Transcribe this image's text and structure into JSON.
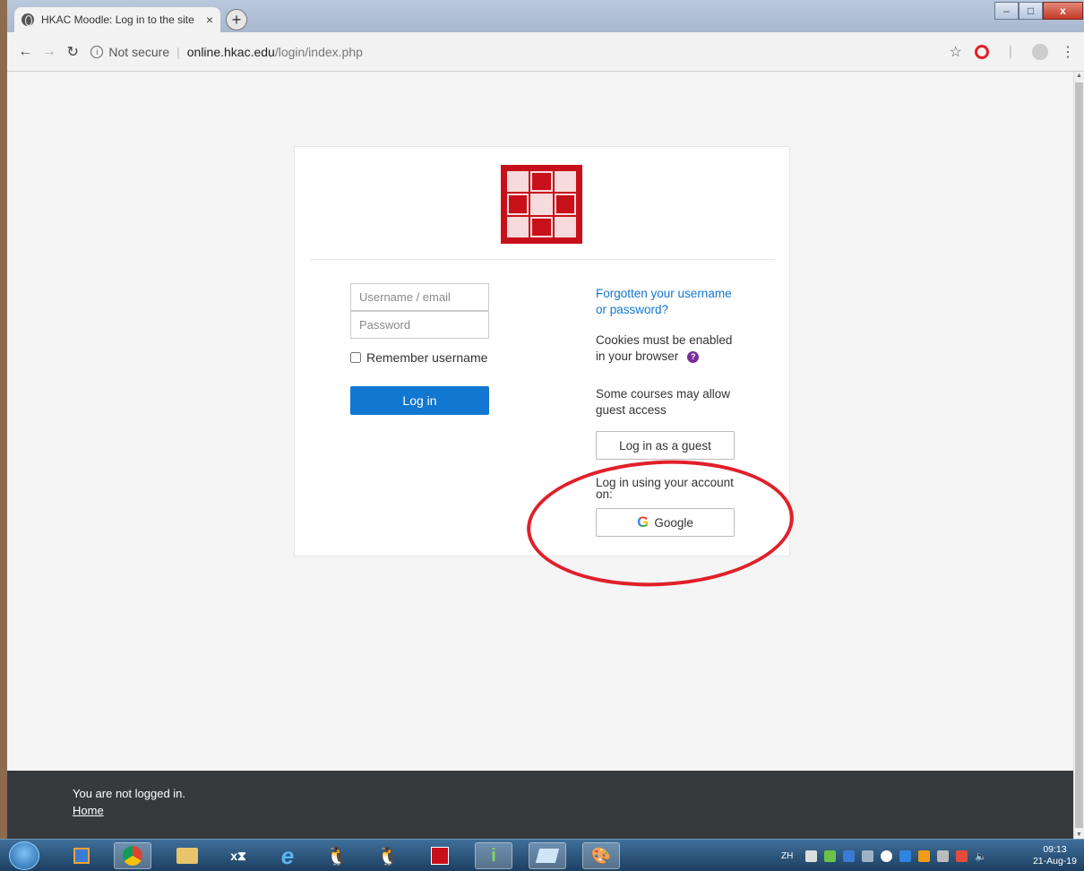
{
  "browser": {
    "tab_title": "HKAC Moodle: Log in to the site",
    "tab_close": "×",
    "new_tab": "+",
    "security_label": "Not secure",
    "url_host": "online.hkac.edu",
    "url_path": "/login/index.php",
    "window_controls": {
      "minimize": "–",
      "maximize": "□",
      "close": "x"
    }
  },
  "login": {
    "username_placeholder": "Username / email",
    "password_placeholder": "Password",
    "remember_label": "Remember username",
    "login_button": "Log in",
    "forgot_line1": "Forgotten your username",
    "forgot_line2": "or password?",
    "cookies_line1": "Cookies must be enabled",
    "cookies_line2": "in your browser",
    "help_icon_glyph": "?",
    "guest_line1": "Some courses may allow",
    "guest_line2": "guest access",
    "guest_button": "Log in as a guest",
    "oauth_line1": "Log in using your account",
    "oauth_line2": "on:",
    "google_button": "Google",
    "google_glyph": "G"
  },
  "footer": {
    "status": "You are not logged in.",
    "home_link": "Home"
  },
  "taskbar": {
    "excel_label": "x⧗",
    "language": "ZH",
    "clock_time": "09:13",
    "clock_date": "21-Aug-19"
  },
  "colors": {
    "primary": "#1177d1",
    "footer_bg": "#373a3c",
    "seal_red": "#c8101a",
    "annotation_red": "#e0202a"
  }
}
